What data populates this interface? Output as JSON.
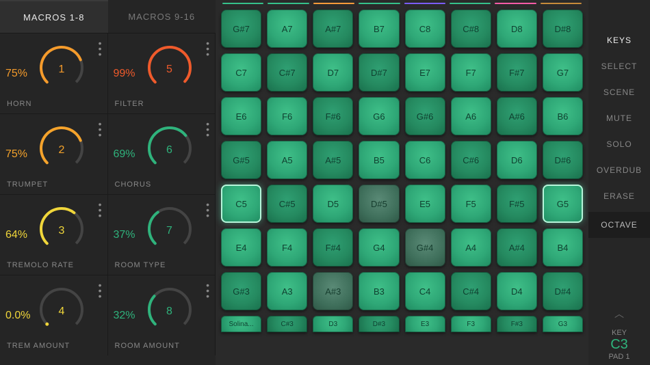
{
  "tabs": {
    "a": "MACROS 1-8",
    "b": "MACROS 9-16"
  },
  "colorstrip": [
    "#35c28b",
    "#35c28b",
    "#ff9c3a",
    "#35c28b",
    "#7b5dff",
    "#35c28b",
    "#ff5ca8",
    "#c78b3a"
  ],
  "macros": [
    {
      "n": "1",
      "pct": "75%",
      "label": "HORN",
      "val": 0.75,
      "color": "#f59b2b"
    },
    {
      "n": "5",
      "pct": "99%",
      "label": "FILTER",
      "val": 0.99,
      "color": "#ef5a2b"
    },
    {
      "n": "2",
      "pct": "75%",
      "label": "TRUMPET",
      "val": 0.75,
      "color": "#f5a32b"
    },
    {
      "n": "6",
      "pct": "69%",
      "label": "CHORUS",
      "val": 0.69,
      "color": "#2fb37c"
    },
    {
      "n": "3",
      "pct": "64%",
      "label": "TREMOLO RATE",
      "val": 0.64,
      "color": "#f0d63a"
    },
    {
      "n": "7",
      "pct": "37%",
      "label": "ROOM TYPE",
      "val": 0.37,
      "color": "#2fb37c"
    },
    {
      "n": "4",
      "pct": "0.0%",
      "label": "TREM AMOUNT",
      "val": 0.0,
      "color": "#f0d63a"
    },
    {
      "n": "8",
      "pct": "32%",
      "label": "ROOM AMOUNT",
      "val": 0.32,
      "color": "#2fb37c"
    }
  ],
  "pads": [
    [
      "G#7",
      "A7",
      "A#7",
      "B7",
      "C8",
      "C#8",
      "D8",
      "D#8"
    ],
    [
      "C7",
      "C#7",
      "D7",
      "D#7",
      "E7",
      "F7",
      "F#7",
      "G7"
    ],
    [
      "E6",
      "F6",
      "F#6",
      "G6",
      "G#6",
      "A6",
      "A#6",
      "B6"
    ],
    [
      "G#5",
      "A5",
      "A#5",
      "B5",
      "C6",
      "C#6",
      "D6",
      "D#6"
    ],
    [
      "C5",
      "C#5",
      "D5",
      "D#5",
      "E5",
      "F5",
      "F#5",
      "G5"
    ],
    [
      "E4",
      "F4",
      "F#4",
      "G4",
      "G#4",
      "A4",
      "A#4",
      "B4"
    ],
    [
      "G#3",
      "A3",
      "A#3",
      "B3",
      "C4",
      "C#4",
      "D4",
      "D#4"
    ],
    [
      "Solina...",
      "C#3",
      "D3",
      "D#3",
      "E3",
      "F3",
      "F#3",
      "G3"
    ]
  ],
  "pad_sel": [
    [
      4,
      0
    ],
    [
      4,
      7
    ]
  ],
  "pad_dim": [
    [
      4,
      3
    ],
    [
      5,
      4
    ],
    [
      6,
      2
    ]
  ],
  "right": {
    "items": [
      "KEYS",
      "SELECT",
      "SCENE",
      "MUTE",
      "SOLO",
      "OVERDUB",
      "ERASE"
    ],
    "active": "KEYS",
    "octave_label": "OCTAVE",
    "key_label": "KEY",
    "key_value": "C3",
    "pad_label": "PAD 1"
  }
}
